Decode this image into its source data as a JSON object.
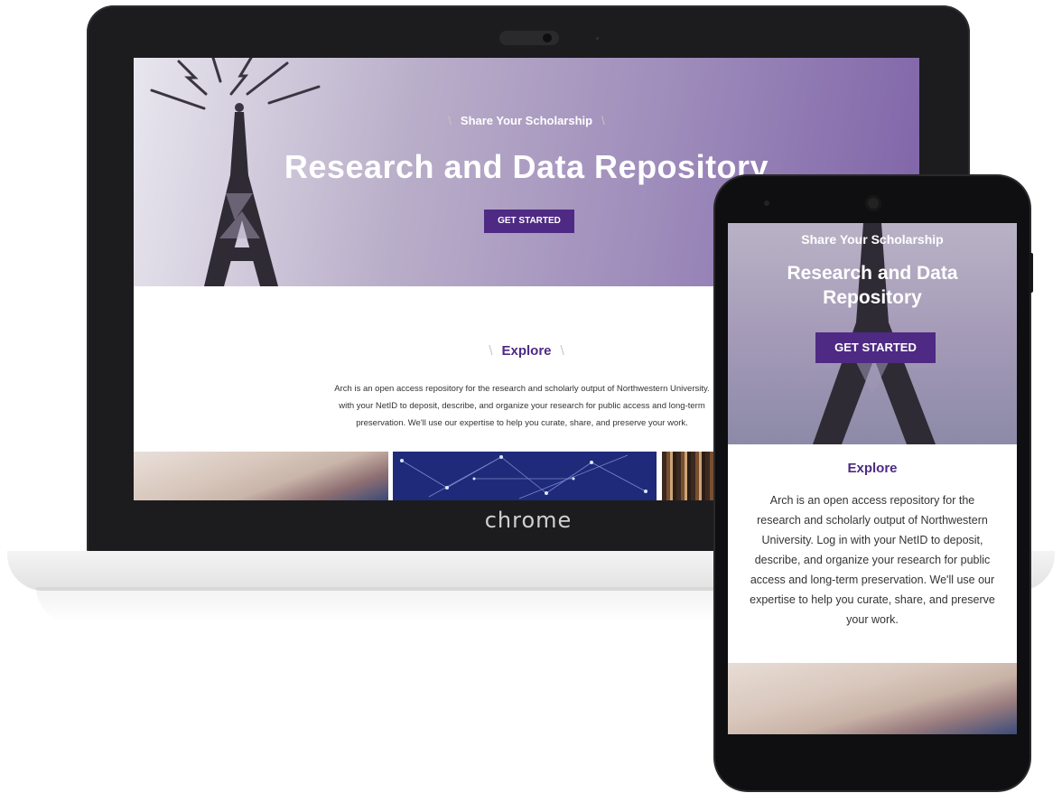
{
  "hero": {
    "eyebrow": "Share Your Scholarship",
    "title": "Research and Data Repository",
    "cta": "GET STARTED"
  },
  "explore": {
    "heading": "Explore",
    "desktop_lines": [
      "Arch is an open access repository for the research and scholarly output of Northwestern University.",
      "with your NetID to deposit, describe, and organize your research for public access and long-term",
      "preservation. We'll use our expertise to help you curate, share, and preserve your work."
    ],
    "mobile_lines": [
      "Arch is an open access repository for the",
      "research and scholarly output of Northwestern",
      "University. Log in with your NetID to deposit,",
      "describe, and organize your research for public",
      "access and long-term preservation. We'll use our",
      "expertise to help you curate, share, and preserve",
      "your work."
    ]
  },
  "mobile_hero": {
    "title_line1": "Research and Data",
    "title_line2": "Repository"
  },
  "device": {
    "laptop_brand": "chrome"
  },
  "colors": {
    "accent": "#4e2a84"
  }
}
